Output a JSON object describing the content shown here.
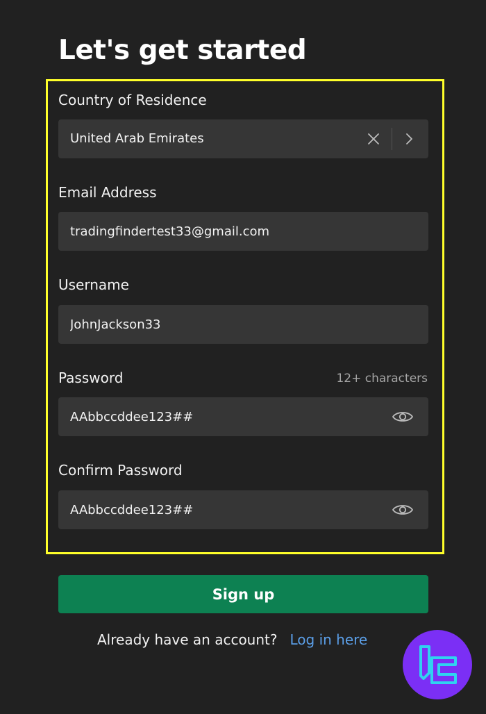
{
  "page": {
    "title": "Let's get started"
  },
  "form": {
    "country": {
      "label": "Country of Residence",
      "value": "United Arab Emirates"
    },
    "email": {
      "label": "Email Address",
      "value": "tradingfindertest33@gmail.com"
    },
    "username": {
      "label": "Username",
      "value": "JohnJackson33"
    },
    "password": {
      "label": "Password",
      "hint": "12+ characters",
      "value": "AAbbccddee123##"
    },
    "confirm_password": {
      "label": "Confirm Password",
      "value": "AAbbccddee123##"
    },
    "submit_label": "Sign up"
  },
  "footer": {
    "prompt": "Already have an account?",
    "login_link": "Log in here"
  },
  "icons": {
    "clear": "close-icon",
    "open_select": "chevron-right-icon",
    "reveal_password": "eye-icon",
    "brand": "brand-logo-icon"
  },
  "colors": {
    "background": "#212121",
    "input_background": "#363636",
    "primary_button": "#0d8152",
    "link": "#5b9fe8",
    "highlight_frame": "#ffff2a",
    "badge": "#7b2ff5",
    "badge_accent": "#2fd3f0"
  }
}
